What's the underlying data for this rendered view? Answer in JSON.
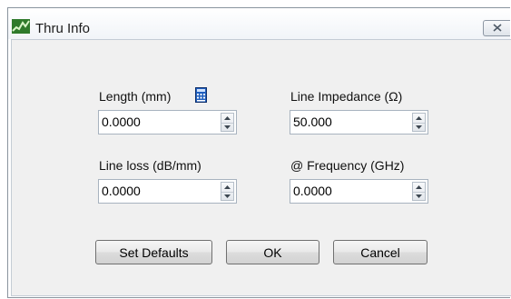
{
  "window": {
    "title": "Thru Info"
  },
  "fields": {
    "length": {
      "label": "Length (mm)",
      "value": "0.0000"
    },
    "impedance": {
      "label": "Line Impedance (Ω)",
      "value": "50.000"
    },
    "loss": {
      "label": "Line loss (dB/mm)",
      "value": "0.0000"
    },
    "frequency": {
      "label": "@ Frequency (GHz)",
      "value": "0.0000"
    }
  },
  "buttons": {
    "set_defaults": "Set Defaults",
    "ok": "OK",
    "cancel": "Cancel"
  },
  "icons": {
    "app": "network-analyzer-icon",
    "close": "close-icon",
    "calculator": "calculator-icon",
    "spinner_up": "arrow-up-icon",
    "spinner_down": "arrow-down-icon"
  },
  "colors": {
    "dialog_bg": "#f0f0f0",
    "calculator_blue": "#1f5fbf"
  }
}
